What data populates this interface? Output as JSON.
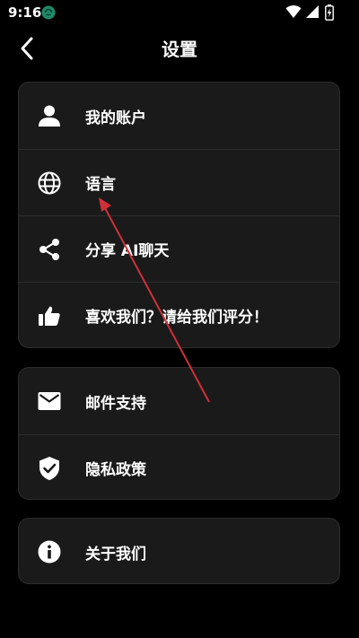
{
  "status_bar": {
    "time": "9:16",
    "app_icon": "circle-app-icon",
    "wifi_icon": "wifi-icon",
    "signal_icon": "signal-icon",
    "battery_icon": "battery-charging-icon"
  },
  "header": {
    "back_icon": "chevron-left-icon",
    "title": "设置"
  },
  "groups": [
    {
      "items": [
        {
          "icon": "person-icon",
          "label": "我的账户"
        },
        {
          "icon": "globe-icon",
          "label": "语言"
        },
        {
          "icon": "share-icon",
          "label": "分享 AI聊天"
        },
        {
          "icon": "thumbs-up-icon",
          "label": "喜欢我们？请给我们评分！"
        }
      ]
    },
    {
      "items": [
        {
          "icon": "mail-icon",
          "label": "邮件支持"
        },
        {
          "icon": "shield-check-icon",
          "label": "隐私政策"
        }
      ]
    },
    {
      "items": [
        {
          "icon": "info-icon",
          "label": "关于我们"
        }
      ]
    }
  ],
  "colors": {
    "background": "#000000",
    "card": "#1a1a1a",
    "divider": "#2c2c2c",
    "text": "#ffffff",
    "annotation_arrow": "#d0303a"
  }
}
